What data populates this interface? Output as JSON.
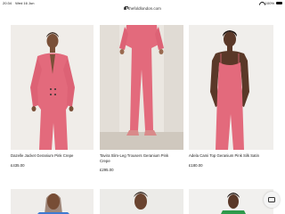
{
  "status_bar": {
    "time": "20:34",
    "date": "Wed 16 Jun",
    "battery": "100%"
  },
  "browser": {
    "url": "thefoldlondon.com"
  },
  "products": [
    {
      "name": "Dazelle Jacket Geranium Pink Crepe",
      "price": "£435.00"
    },
    {
      "name": "Tavira Slim-Leg Trousers Geranium Pink Crepe",
      "price": "£295.00"
    },
    {
      "name": "Adela Cami Top Geranium Pink Silk Satin",
      "price": "£180.00"
    }
  ],
  "colors": {
    "accent_pink": "#e36a7c",
    "background": "#ffffff"
  },
  "icons": {
    "chat": "chat-icon",
    "lock": "lock-icon",
    "wifi": "wifi-icon",
    "battery": "battery-icon"
  }
}
